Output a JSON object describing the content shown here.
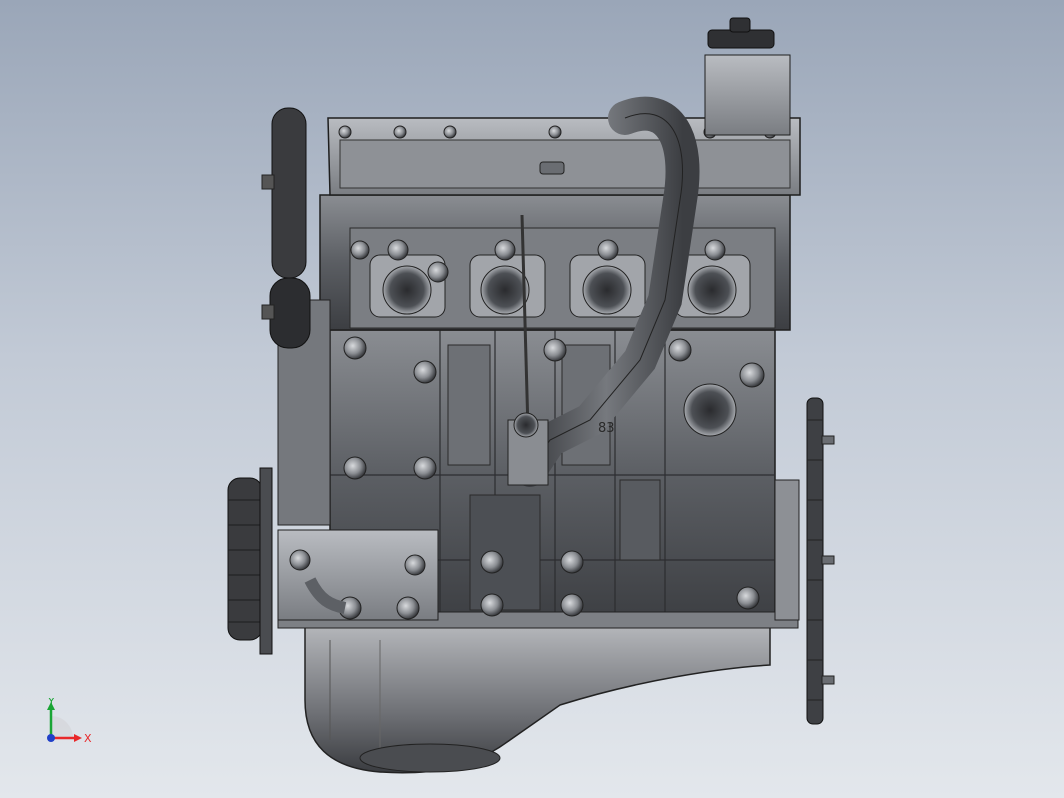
{
  "viewport": {
    "background_top": "#9aa6b8",
    "background_bottom": "#e3e7ec",
    "model_description_icon": "engine-model"
  },
  "triad": {
    "x_label": "X",
    "y_label": "Y",
    "x_color": "#e8282a",
    "y_color": "#1aa535",
    "z_color": "#2040c8"
  },
  "model": {
    "casting_number": "83"
  }
}
